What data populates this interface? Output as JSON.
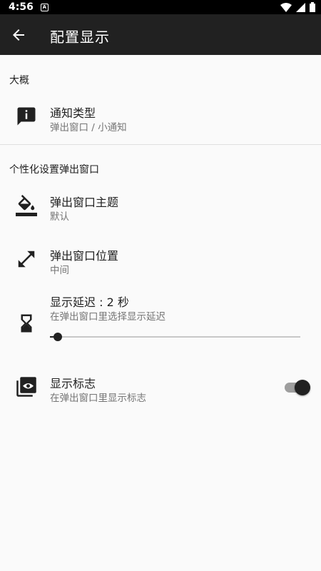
{
  "status_bar": {
    "time": "4:56",
    "notif_glyph": "A"
  },
  "app_bar": {
    "title": "配置显示",
    "back_icon": "arrow-back-icon"
  },
  "sections": [
    {
      "title": "大概",
      "items": [
        {
          "title": "通知类型",
          "summary": "弹出窗口 / 小通知",
          "icon": "info-message-icon"
        }
      ]
    },
    {
      "title": "个性化设置弹出窗口",
      "items": [
        {
          "title": "弹出窗口主题",
          "summary": "默认",
          "icon": "paint-bucket-icon"
        },
        {
          "title": "弹出窗口位置",
          "summary": "中间",
          "icon": "resize-arrows-icon"
        },
        {
          "title": "显示延迟 : 2 秒",
          "summary": "在弹出窗口里选择显示延迟",
          "icon": "hourglass-icon",
          "slider_value": 2,
          "slider_fraction": 0.03
        },
        {
          "title": "显示标志",
          "summary": "在弹出窗口里显示标志",
          "icon": "badge-eye-icon",
          "toggle_on": true
        }
      ]
    }
  ],
  "colors": {
    "app_bar": "#212121",
    "background": "#fafafa",
    "accent": "#212121",
    "secondary_text": "#757575"
  }
}
